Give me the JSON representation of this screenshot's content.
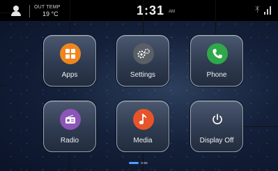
{
  "status_bar": {
    "outside_temp_label": "OUT TEMP",
    "outside_temp_value": "19 °C",
    "clock": "1:31",
    "ampm": "AM",
    "bluetooth_icon": "bluetooth-icon",
    "signal_icon": "signal-icon"
  },
  "tiles": [
    {
      "label": "Apps",
      "icon": "apps-grid-icon",
      "color": "#f0851e"
    },
    {
      "label": "Settings",
      "icon": "gears-icon",
      "color": "#5a5f66"
    },
    {
      "label": "Phone",
      "icon": "phone-handset-icon",
      "color": "#2fa84a"
    },
    {
      "label": "Radio",
      "icon": "radio-icon",
      "color": "#8c55b8"
    },
    {
      "label": "Media",
      "icon": "music-note-icon",
      "color": "#e8542a"
    },
    {
      "label": "Display Off",
      "icon": "power-icon",
      "color": "#ffffff"
    }
  ],
  "pager": {
    "pages": 2,
    "current": 1
  }
}
